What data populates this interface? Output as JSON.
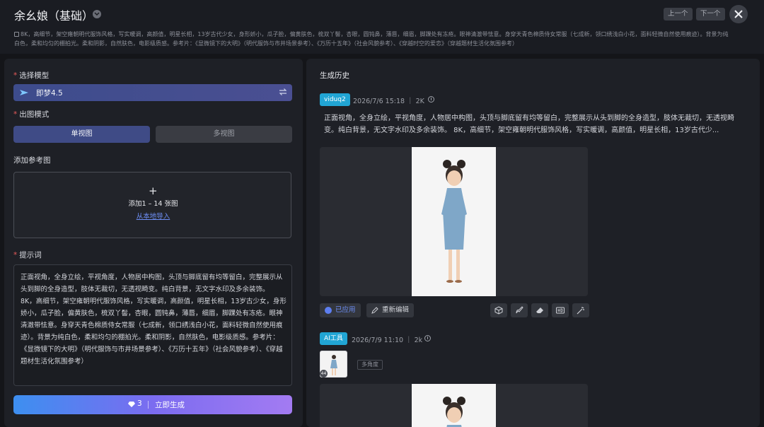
{
  "header": {
    "title": "余幺娘（基础）",
    "prev_label": "上一个",
    "next_label": "下一个",
    "description": "8K，高细节，架空雍朝明代服饰风格，写实暖调，高颜值，明星长相，13岁古代少女，身形娇小，瓜子脸，偏黄肤色，梳双丫髻，杏眼，圆钝鼻，薄唇，细眉，脚踝处有冻疮。眼神清澈带怯意。身穿天青色棉质侍女常服（七成新，领口绣浅白小花，面料轻微自然使用痕迹）。背景为纯白色，柔和均匀的棚拍光。柔和阴影，自然肤色，电影级质感。参考片：《显微镜下的大明》（明代服饰与市井场景参考）、《万历十五年》（社会风貌参考）、《穿越时空的爱恋》（穿越题材生活化氛围参考）"
  },
  "left": {
    "model_label": "选择模型",
    "model_name": "即梦4.5",
    "mode_label": "出图模式",
    "mode_single": "单视图",
    "mode_multi": "多视图",
    "ref_label": "添加参考图",
    "upload_plus": "+",
    "upload_text": "添加1 – 14 张图",
    "upload_local": "从本地导入",
    "prompt_label": "提示词",
    "prompt_p1": "正面视角，全身立绘，平视角度，人物居中构图，头顶与脚底留有均等留白，完整展示从头到脚的全身造型，肢体无裁切，无透视畸变。纯白背景，无文字水印及多余装饰。",
    "prompt_p2": "8K，高细节，架空雍朝明代服饰风格，写实暖调，高颜值，明星长相，13岁古少女，身形娇小，瓜子脸，偏黄肤色，梳双丫髻，杏眼，圆钝鼻，薄唇，细眉，脚踝处有冻疮。眼神清澈带怯意。身穿天青色棉质侍女常服（七成新，领口绣浅白小花，面料轻微自然使用痕迹）。背景为纯白色，柔和均匀的棚拍光。柔和阴影，自然肤色，电影级质感。参考片：《显微镜下的大明》（明代服饰与市井场景参考）、《万历十五年》（社会风貌参考）、《穿越题材生活化氛围参考）",
    "gen_cost": "3",
    "gen_label": "立即生成"
  },
  "right": {
    "history_title": "生成历史",
    "item1": {
      "tag": "viduq2",
      "meta": "2026/7/6 15:18 ｜ 2K",
      "text": "正面视角，全身立绘，平视角度，人物居中构图，头顶与脚底留有均等留白，完整展示从头到脚的全身造型，肢体无裁切，无透视畸变。纯白背景，无文字水印及多余装饰。 8K，高细节，架空雍朝明代服饰风格，写实暖调，高颜值，明星长相，13岁古代少...",
      "applied": "已应用",
      "reedit": "重新编辑"
    },
    "item2": {
      "tag": "AI工具",
      "meta": "2026/7/9 11:10 ｜ 2k",
      "thumb_badge": "44",
      "multi_tag": "多角度"
    }
  },
  "colors": {
    "accent": "#5d7ef0",
    "tag": "#21a5d4",
    "panel": "#1e2026",
    "background": "#141519"
  }
}
